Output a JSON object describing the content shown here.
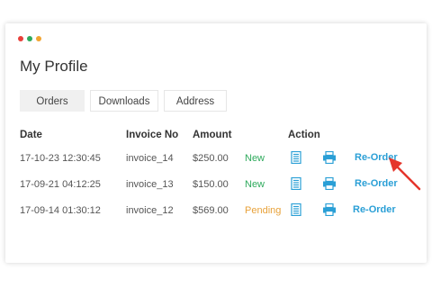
{
  "window": {
    "dots": [
      "#e8403a",
      "#2eaa5c",
      "#f2a531"
    ]
  },
  "page": {
    "title": "My Profile"
  },
  "tabs": [
    {
      "label": "Orders",
      "active": true
    },
    {
      "label": "Downloads",
      "active": false
    },
    {
      "label": "Address",
      "active": false
    }
  ],
  "table": {
    "headers": {
      "date": "Date",
      "invoice": "Invoice No",
      "amount": "Amount",
      "action": "Action"
    },
    "rows": [
      {
        "date": "17-10-23 12:30:45",
        "invoice": "invoice_14",
        "amount": "$250.00",
        "status": "New",
        "reorder": "Re-Order"
      },
      {
        "date": "17-09-21 04:12:25",
        "invoice": "invoice_13",
        "amount": "$150.00",
        "status": "New",
        "reorder": "Re-Order"
      },
      {
        "date": "17-09-14 01:30:12",
        "invoice": "invoice_12",
        "amount": "$569.00",
        "status": "Pending",
        "reorder": "Re-Order"
      }
    ]
  },
  "icons": {
    "view": "document-list-icon",
    "print": "printer-icon",
    "pointer": "red-arrow-icon"
  },
  "colors": {
    "accent": "#2a9fd6",
    "status_new": "#2eaa5c",
    "status_pending": "#e8a23a",
    "arrow": "#e5352b"
  }
}
